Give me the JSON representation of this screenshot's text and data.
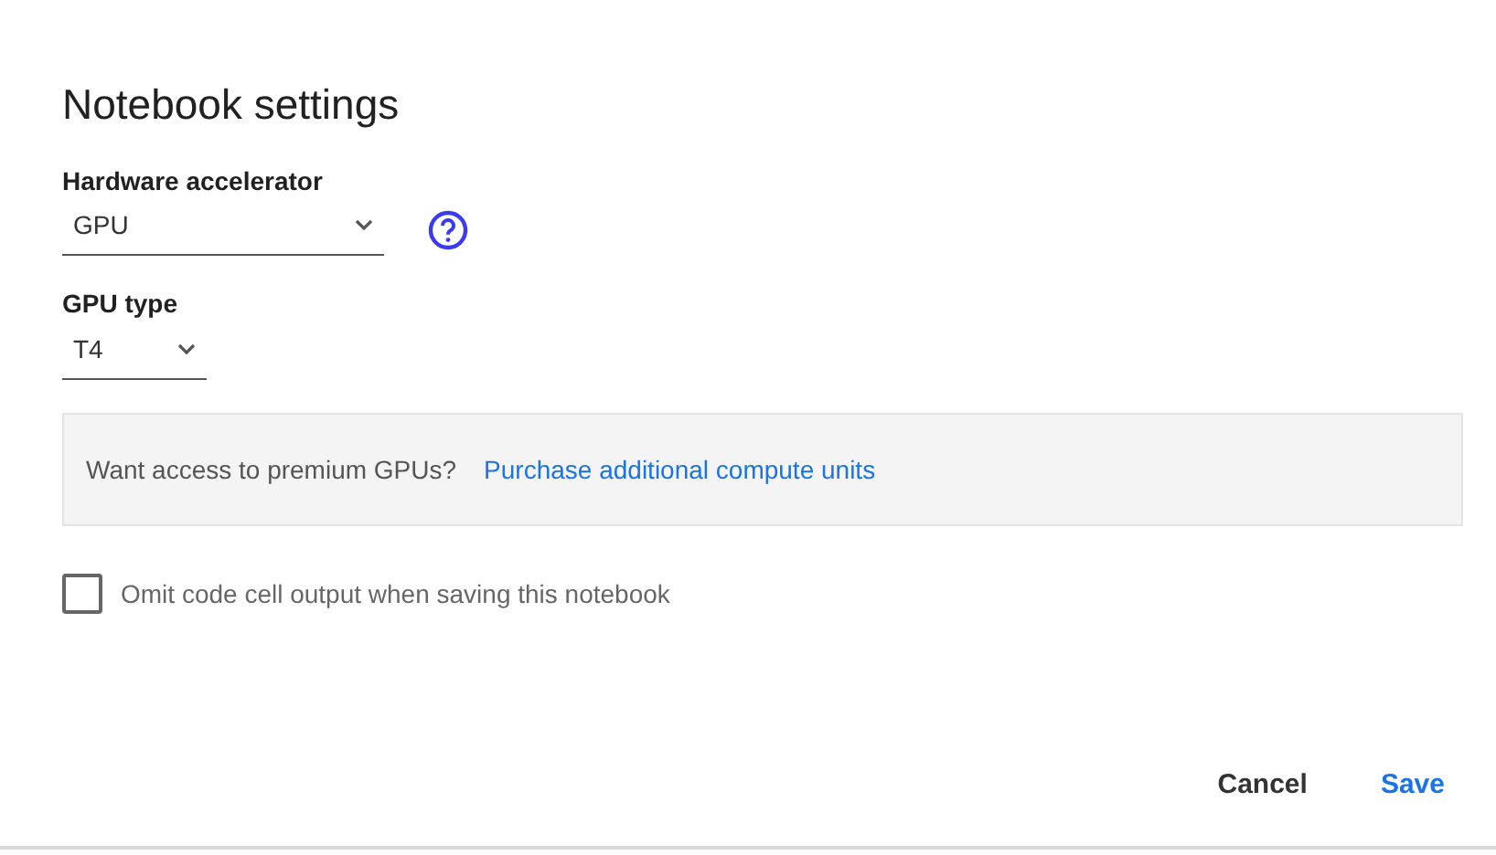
{
  "dialog": {
    "title": "Notebook settings",
    "fields": [
      {
        "label": "Hardware accelerator",
        "value": "GPU",
        "help": true
      },
      {
        "label": "GPU type",
        "value": "T4",
        "help": false
      }
    ],
    "banner": {
      "text": "Want access to premium GPUs?",
      "link": "Purchase additional compute units"
    },
    "checkbox": {
      "label": "Omit code cell output when saving this notebook",
      "checked": false
    },
    "buttons": [
      {
        "label": "Cancel",
        "kind": "secondary"
      },
      {
        "label": "Save",
        "kind": "primary"
      }
    ]
  }
}
